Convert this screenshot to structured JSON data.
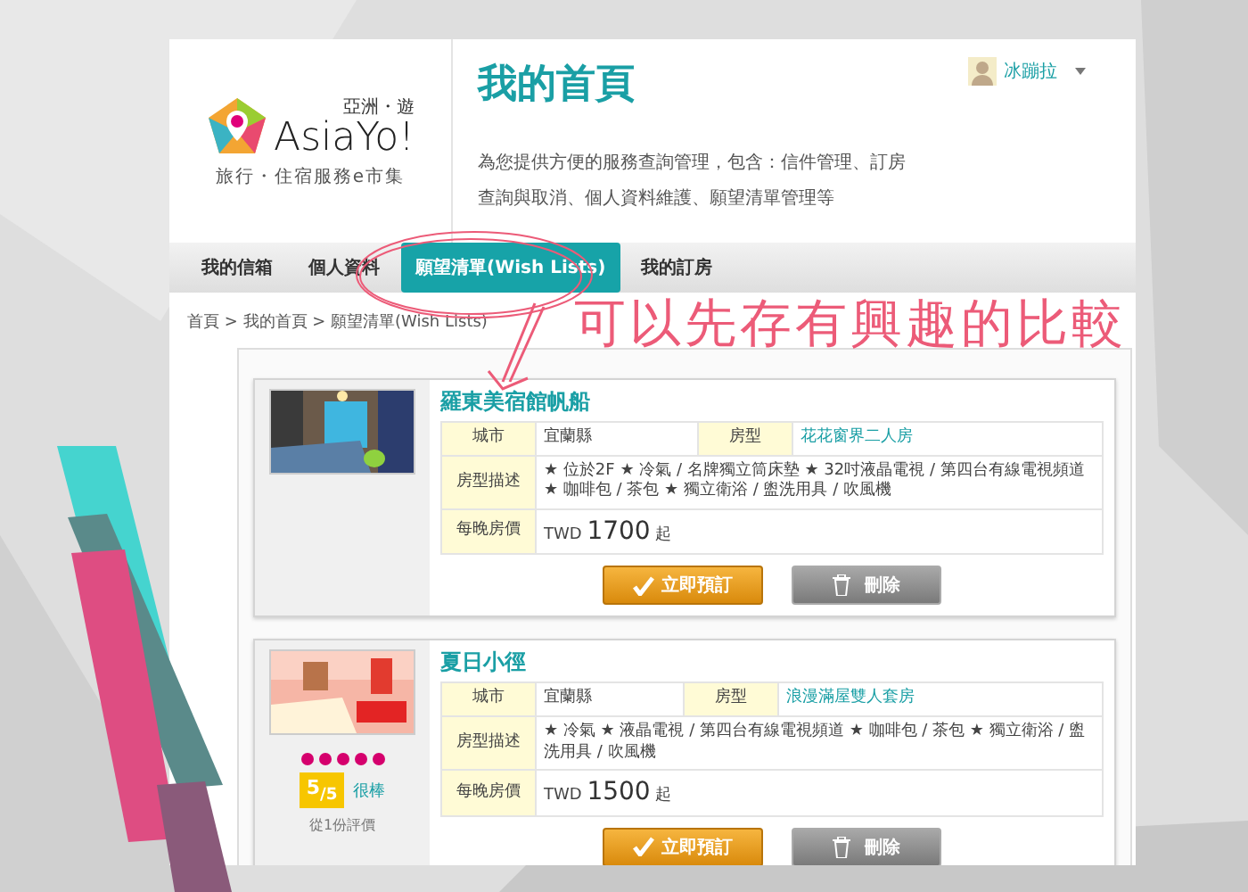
{
  "logo": {
    "region": "亞洲・遊",
    "name": "AsiaYo",
    "mark": "!",
    "tagline": "旅行・住宿服務e市集"
  },
  "header": {
    "title": "我的首頁",
    "description": "為您提供方便的服務查詢管理，包含：信件管理、訂房查詢與取消、個人資料維護、願望清單管理等"
  },
  "user": {
    "name": "冰蹦拉"
  },
  "nav": [
    {
      "label": "我的信箱",
      "selected": false
    },
    {
      "label": "個人資料",
      "selected": false
    },
    {
      "label": "願望清單(Wish Lists)",
      "selected": true
    },
    {
      "label": "我的訂房",
      "selected": false
    }
  ],
  "breadcrumb": "首頁 > 我的首頁 > 願望清單(Wish Lists)",
  "annotation": {
    "text": "可以先存有興趣的比較"
  },
  "wishlist": [
    {
      "name": "羅東美宿館帆船",
      "city_label": "城市",
      "city": "宜蘭縣",
      "type_label": "房型",
      "room_type": "花花窗界二人房",
      "desc_label": "房型描述",
      "description": "★ 位於2F ★ 冷氣 / 名牌獨立筒床墊 ★ 32吋液晶電視 / 第四台有線電視頻道 ★ 咖啡包 / 茶包 ★ 獨立衛浴 / 盥洗用具 / 吹風機",
      "price_label": "每晚房價",
      "currency": "TWD",
      "price": "1700",
      "price_suffix": "起",
      "book": "立即預訂",
      "delete": "刪除"
    },
    {
      "name": "夏日小徑",
      "city_label": "城市",
      "city": "宜蘭縣",
      "type_label": "房型",
      "room_type": "浪漫滿屋雙人套房",
      "desc_label": "房型描述",
      "description": "★ 冷氣 ★ 液晶電視 / 第四台有線電視頻道 ★ 咖啡包 / 茶包 ★ 獨立衛浴 / 盥洗用具 / 吹風機",
      "price_label": "每晚房價",
      "currency": "TWD",
      "price": "1500",
      "price_suffix": "起",
      "book": "立即預訂",
      "delete": "刪除",
      "rating": {
        "stars": 5,
        "score": "5$_{/5}$",
        "verdict": "很棒",
        "count": "從1份評價"
      }
    }
  ]
}
